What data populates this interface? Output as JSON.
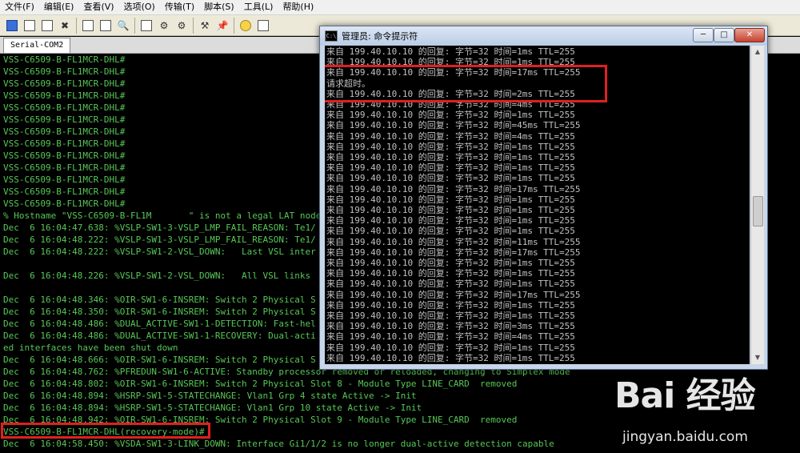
{
  "menu": [
    "文件(F)",
    "编辑(E)",
    "查看(V)",
    "选项(O)",
    "传输(T)",
    "脚本(S)",
    "工具(L)",
    "帮助(H)"
  ],
  "toolbar": [
    "new-session-icon",
    "connect-icon",
    "reconnect-icon",
    "disconnect-icon",
    "copy-icon",
    "paste-icon",
    "find-icon",
    "print-icon",
    "settings-icon",
    "options-icon",
    "keymap-icon",
    "pin-icon",
    "help-icon",
    "about-icon"
  ],
  "tab": {
    "label": "Serial-COM2"
  },
  "terminal": {
    "lines": [
      "VSS-C6509-B-FL1MCR-DHL#",
      "VSS-C6509-B-FL1MCR-DHL#",
      "VSS-C6509-B-FL1MCR-DHL#",
      "VSS-C6509-B-FL1MCR-DHL#",
      "VSS-C6509-B-FL1MCR-DHL#",
      "VSS-C6509-B-FL1MCR-DHL#",
      "VSS-C6509-B-FL1MCR-DHL#",
      "VSS-C6509-B-FL1MCR-DHL#",
      "VSS-C6509-B-FL1MCR-DHL#",
      "VSS-C6509-B-FL1MCR-DHL#",
      "VSS-C6509-B-FL1MCR-DHL#",
      "VSS-C6509-B-FL1MCR-DHL#",
      "VSS-C6509-B-FL1MCR-DHL#",
      "% Hostname \"VSS-C6509-B-FL1M       \" is not a legal LAT node",
      "Dec  6 16:04:47.638: %VSLP-SW1-3-VSLP_LMP_FAIL_REASON: Te1/",
      "Dec  6 16:04:48.222: %VSLP-SW1-3-VSLP_LMP_FAIL_REASON: Te1/",
      "Dec  6 16:04:48.222: %VSLP-SW1-2-VSL_DOWN:   Last VSL inter",
      "",
      "Dec  6 16:04:48.226: %VSLP-SW1-2-VSL_DOWN:   All VSL links",
      "",
      "Dec  6 16:04:48.346: %OIR-SW1-6-INSREM: Switch 2 Physical S",
      "Dec  6 16:04:48.350: %OIR-SW1-6-INSREM: Switch 2 Physical S",
      "Dec  6 16:04:48.486: %DUAL_ACTIVE-SW1-1-DETECTION: Fast-hel",
      "Dec  6 16:04:48.486: %DUAL_ACTIVE-SW1-1-RECOVERY: Dual-acti",
      "ed interfaces have been shut down",
      "Dec  6 16:04:48.666: %OIR-SW1-6-INSREM: Switch 2 Physical S",
      "Dec  6 16:04:48.762: %PFREDUN-SW1-6-ACTIVE: Standby processor removed or reloaded, changing to Simplex mode",
      "Dec  6 16:04:48.802: %OIR-SW1-6-INSREM: Switch 2 Physical Slot 8 - Module Type LINE_CARD  removed",
      "Dec  6 16:04:48.894: %HSRP-SW1-5-STATECHANGE: Vlan1 Grp 4 state Active -> Init",
      "Dec  6 16:04:48.894: %HSRP-SW1-5-STATECHANGE: Vlan1 Grp 10 state Active -> Init",
      "Dec  6 16:04:48.942: %OIR-SW1-6-INSREM: Switch 2 Physical Slot 9 - Module Type LINE_CARD  removed",
      "VSS-C6509-B-FL1MCR-DHL(recovery-mode)#",
      "Dec  6 16:04:58.450: %VSDA-SW1-3-LINK_DOWN: Interface Gi1/1/2 is no longer dual-active detection capable"
    ]
  },
  "cmd": {
    "title": "管理员: 命令提示符",
    "icon_text": "C:\\",
    "buttons": {
      "minimize": "─",
      "maximize": "□",
      "close": "✕"
    },
    "lines": [
      "来自 199.40.10.10 的回复: 字节=32 时间=1ms TTL=255",
      "来自 199.40.10.10 的回复: 字节=32 时间=1ms TTL=255",
      "来自 199.40.10.10 的回复: 字节=32 时间=17ms TTL=255",
      "请求超时。",
      "来自 199.40.10.10 的回复: 字节=32 时间=2ms TTL=255",
      "来自 199.40.10.10 的回复: 字节=32 时间=4ms TTL=255",
      "来自 199.40.10.10 的回复: 字节=32 时间=1ms TTL=255",
      "来自 199.40.10.10 的回复: 字节=32 时间=45ms TTL=255",
      "来自 199.40.10.10 的回复: 字节=32 时间=4ms TTL=255",
      "来自 199.40.10.10 的回复: 字节=32 时间=1ms TTL=255",
      "来自 199.40.10.10 的回复: 字节=32 时间=1ms TTL=255",
      "来自 199.40.10.10 的回复: 字节=32 时间=1ms TTL=255",
      "来自 199.40.10.10 的回复: 字节=32 时间=1ms TTL=255",
      "来自 199.40.10.10 的回复: 字节=32 时间=17ms TTL=255",
      "来自 199.40.10.10 的回复: 字节=32 时间=1ms TTL=255",
      "来自 199.40.10.10 的回复: 字节=32 时间=1ms TTL=255",
      "来自 199.40.10.10 的回复: 字节=32 时间=1ms TTL=255",
      "来自 199.40.10.10 的回复: 字节=32 时间=1ms TTL=255",
      "来自 199.40.10.10 的回复: 字节=32 时间=11ms TTL=255",
      "来自 199.40.10.10 的回复: 字节=32 时间=17ms TTL=255",
      "来自 199.40.10.10 的回复: 字节=32 时间=1ms TTL=255",
      "来自 199.40.10.10 的回复: 字节=32 时间=1ms TTL=255",
      "来自 199.40.10.10 的回复: 字节=32 时间=1ms TTL=255",
      "来自 199.40.10.10 的回复: 字节=32 时间=17ms TTL=255",
      "来自 199.40.10.10 的回复: 字节=32 时间=1ms TTL=255",
      "来自 199.40.10.10 的回复: 字节=32 时间=1ms TTL=255",
      "来自 199.40.10.10 的回复: 字节=32 时间=3ms TTL=255",
      "来自 199.40.10.10 的回复: 字节=32 时间=4ms TTL=255",
      "来自 199.40.10.10 的回复: 字节=32 时间=1ms TTL=255",
      "来自 199.40.10.10 的回复: 字节=32 时间=1ms TTL=255"
    ]
  },
  "watermark": {
    "logo": "Bai 经验",
    "url": "jingyan.baidu.com"
  },
  "colors": {
    "terminal_text": "#57c757",
    "cmd_text": "#c0c0c0",
    "highlight": "#e02020"
  }
}
